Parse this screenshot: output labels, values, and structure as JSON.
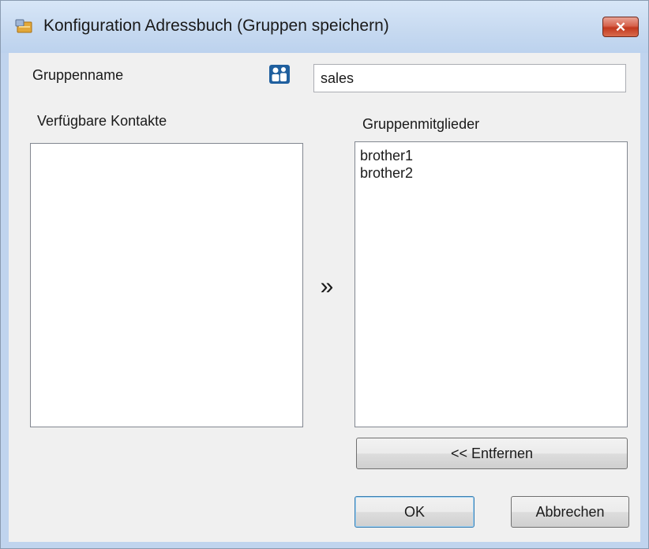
{
  "window": {
    "title": "Konfiguration Adressbuch (Gruppen speichern)",
    "close_label": "✕"
  },
  "form": {
    "group_name_label": "Gruppenname",
    "group_name_value": "sales",
    "available_label": "Verfügbare Kontakte",
    "members_label": "Gruppenmitglieder",
    "available_contacts": [],
    "group_members": [
      "brother1",
      "brother2"
    ],
    "add_arrow": "»"
  },
  "buttons": {
    "remove": "<< Entfernen",
    "ok": "OK",
    "cancel": "Abbrechen"
  },
  "colors": {
    "titlebar": "#c6d9f0",
    "client_background": "#f0f0f0",
    "close_button": "#c2391f",
    "group_icon": "#1f5f9e"
  }
}
